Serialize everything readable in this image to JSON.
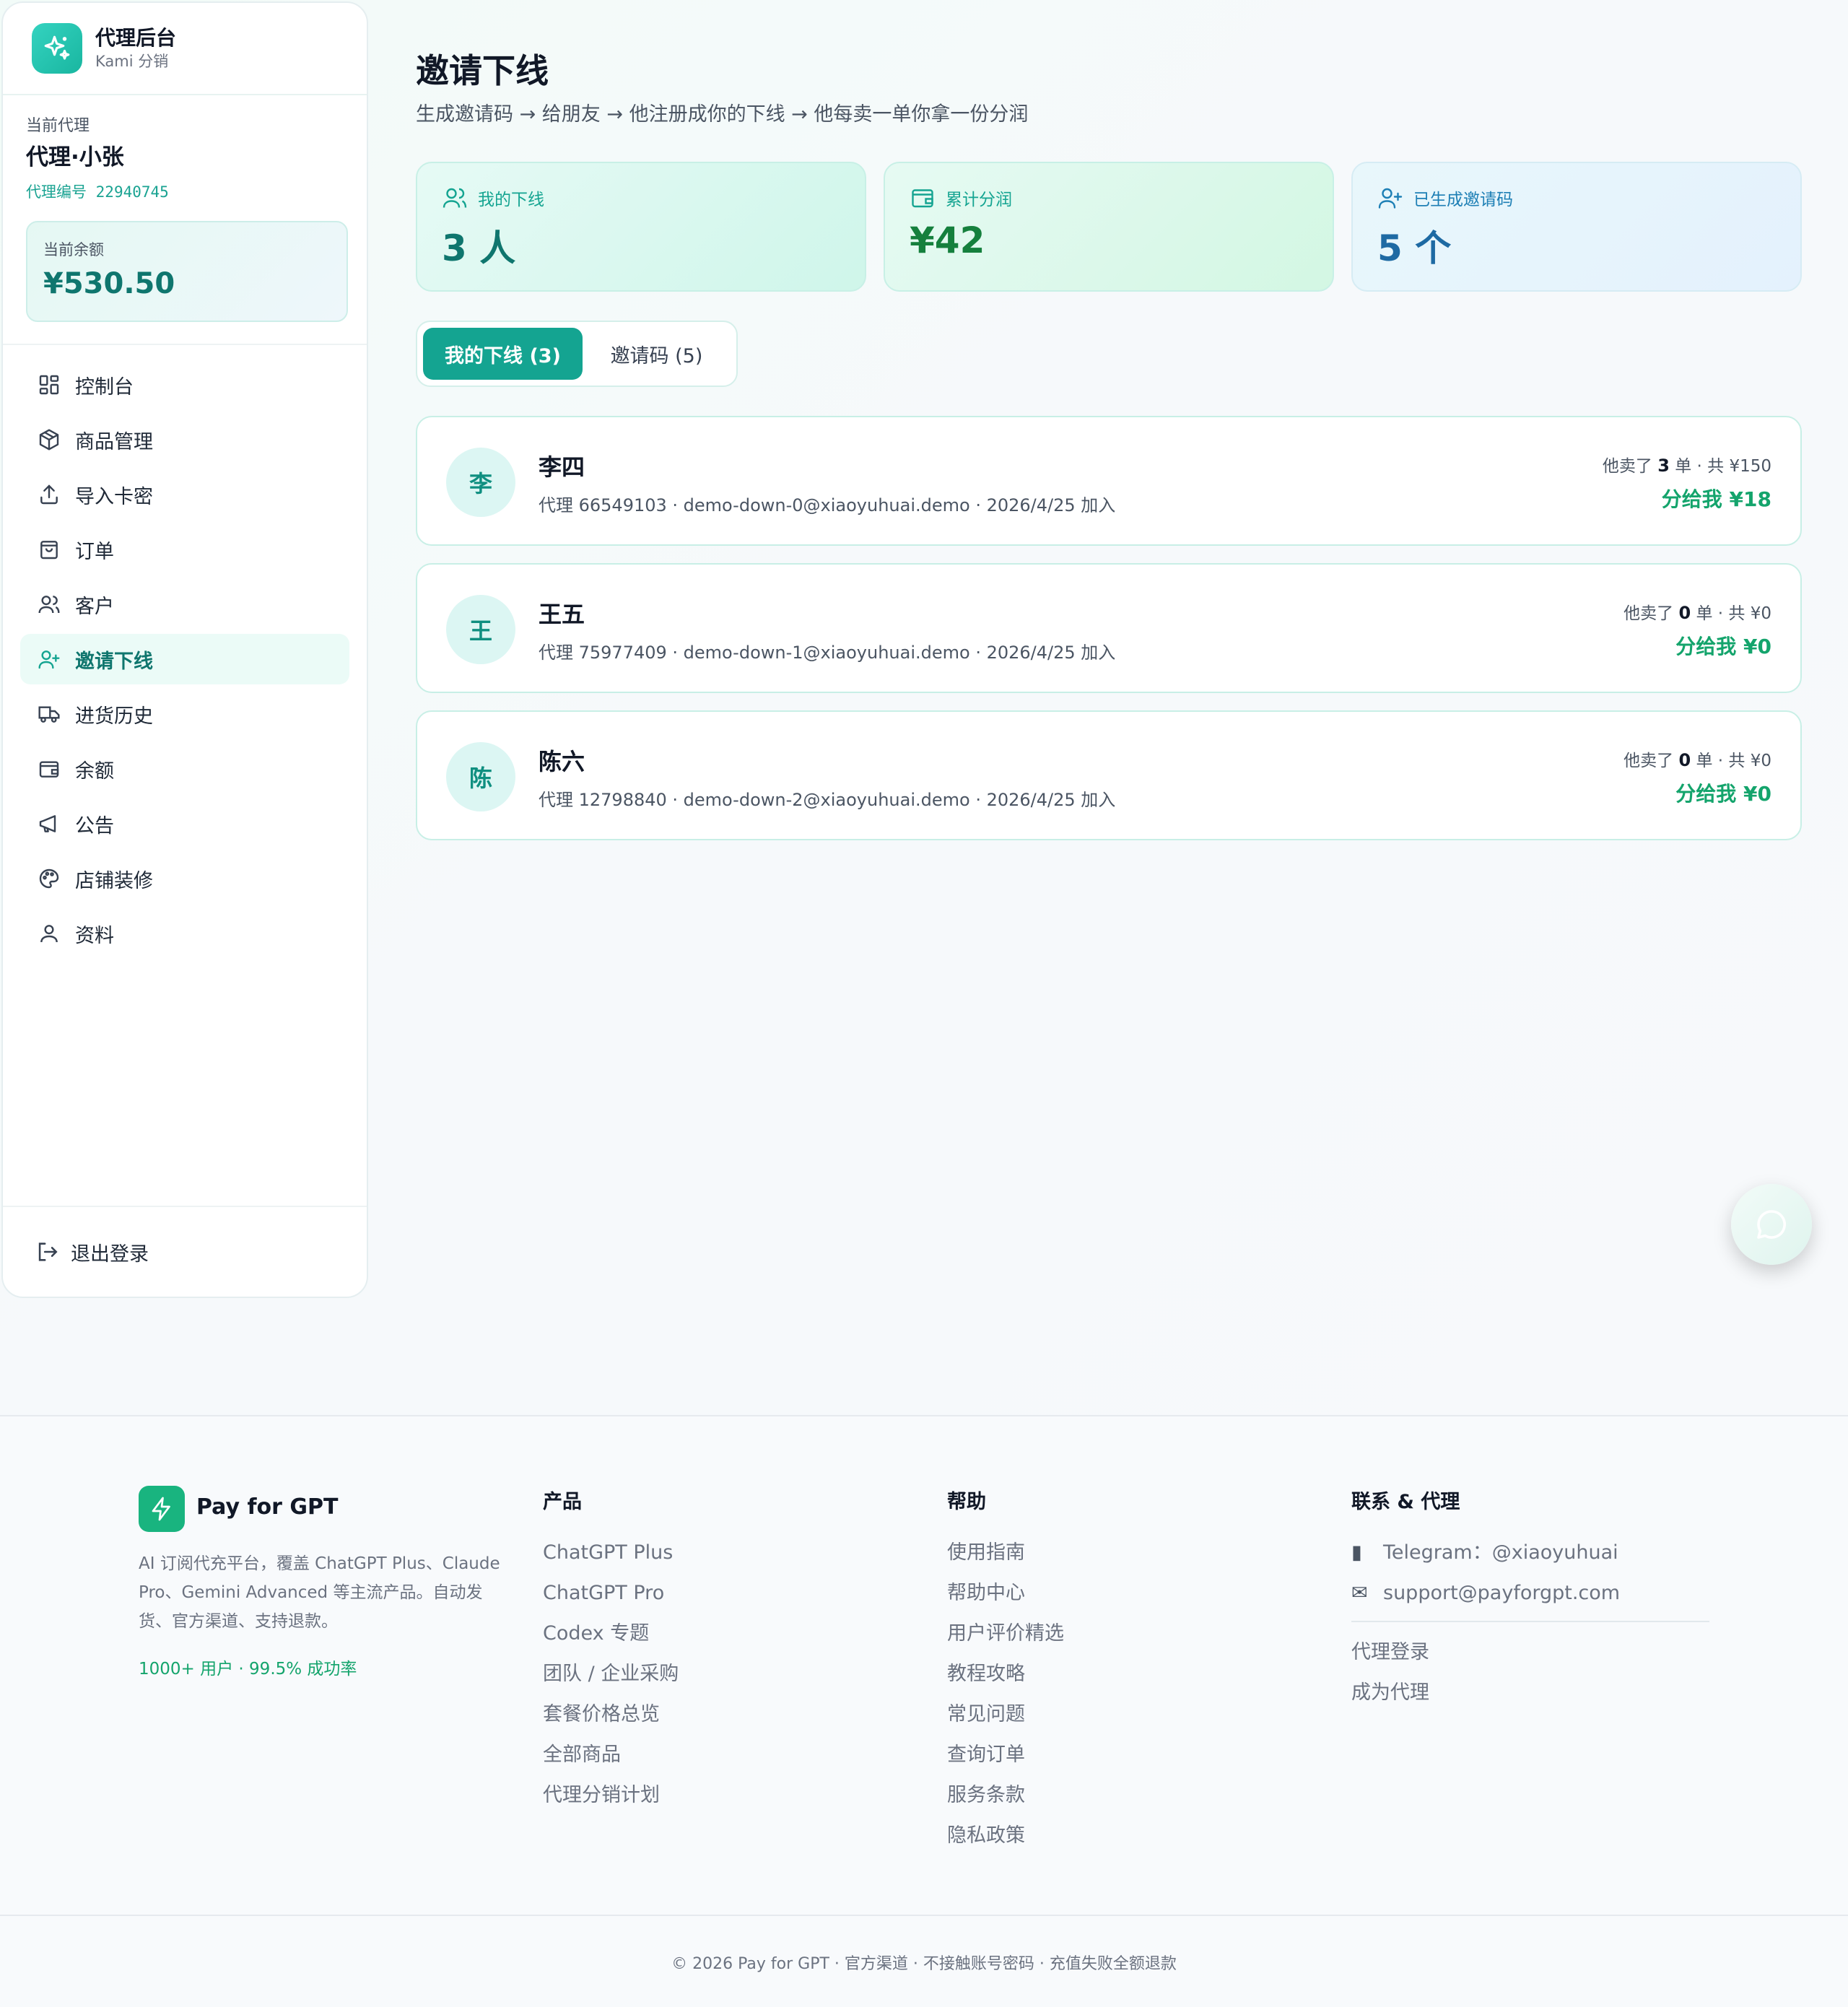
{
  "brand": {
    "title": "代理后台",
    "subtitle": "Kami 分销"
  },
  "agent": {
    "label": "当前代理",
    "name": "代理·小张",
    "code_label": "代理编号",
    "code": "22940745",
    "balance_label": "当前余额",
    "balance": "¥530.50"
  },
  "nav": [
    {
      "label": "控制台",
      "icon": "grid-icon"
    },
    {
      "label": "商品管理",
      "icon": "box-icon"
    },
    {
      "label": "导入卡密",
      "icon": "upload-icon"
    },
    {
      "label": "订单",
      "icon": "bag-icon"
    },
    {
      "label": "客户",
      "icon": "users-icon"
    },
    {
      "label": "邀请下线",
      "icon": "user-plus-icon",
      "active": true
    },
    {
      "label": "进货历史",
      "icon": "truck-icon"
    },
    {
      "label": "余额",
      "icon": "wallet-icon"
    },
    {
      "label": "公告",
      "icon": "megaphone-icon"
    },
    {
      "label": "店铺装修",
      "icon": "palette-icon"
    },
    {
      "label": "资料",
      "icon": "user-icon"
    }
  ],
  "logout": "退出登录",
  "page": {
    "title": "邀请下线",
    "subtitle": "生成邀请码 → 给朋友 → 他注册成你的下线 → 他每卖一单你拿一份分润"
  },
  "stats": [
    {
      "label": "我的下线",
      "value": "3 人"
    },
    {
      "label": "累计分润",
      "value": "¥42"
    },
    {
      "label": "已生成邀请码",
      "value": "5 个"
    }
  ],
  "tabs": [
    {
      "label": "我的下线 (3)"
    },
    {
      "label": "邀请码 (5)"
    }
  ],
  "downlines": [
    {
      "avatar": "李",
      "name": "李四",
      "meta": "代理 66549103 · demo-down-0@xiaoyuhuai.demo · 2026/4/25 加入",
      "sold_pre": "他卖了 ",
      "sold_count": "3",
      "sold_post": " 单 · 共 ¥150",
      "share": "分给我 ¥18"
    },
    {
      "avatar": "王",
      "name": "王五",
      "meta": "代理 75977409 · demo-down-1@xiaoyuhuai.demo · 2026/4/25 加入",
      "sold_pre": "他卖了 ",
      "sold_count": "0",
      "sold_post": " 单 · 共 ¥0",
      "share": "分给我 ¥0"
    },
    {
      "avatar": "陈",
      "name": "陈六",
      "meta": "代理 12798840 · demo-down-2@xiaoyuhuai.demo · 2026/4/25 加入",
      "sold_pre": "他卖了 ",
      "sold_count": "0",
      "sold_post": " 单 · 共 ¥0",
      "share": "分给我 ¥0"
    }
  ],
  "footer": {
    "brand": "Pay for GPT",
    "desc": "AI 订阅代充平台，覆盖 ChatGPT Plus、Claude Pro、Gemini Advanced 等主流产品。自动发货、官方渠道、支持退款。",
    "stats": "1000+ 用户 · 99.5% 成功率",
    "products": {
      "title": "产品",
      "links": [
        "ChatGPT Plus",
        "ChatGPT Pro",
        "Codex 专题",
        "团队 / 企业采购",
        "套餐价格总览",
        "全部商品",
        "代理分销计划"
      ]
    },
    "help": {
      "title": "帮助",
      "links": [
        "使用指南",
        "帮助中心",
        "用户评价精选",
        "教程攻略",
        "常见问题",
        "查询订单",
        "服务条款",
        "隐私政策"
      ]
    },
    "contact": {
      "title": "联系 & 代理",
      "telegram": "Telegram：@xiaoyuhuai",
      "email": "support@payforgpt.com",
      "links": [
        "代理登录",
        "成为代理"
      ]
    },
    "copyright": "© 2026 Pay for GPT · 官方渠道 · 不接触账号密码 · 充值失败全额退款"
  },
  "colors": {
    "accent": "#14a491",
    "accent_dark": "#0f766e",
    "green": "#14a46c",
    "blue": "#1e6aa3"
  }
}
